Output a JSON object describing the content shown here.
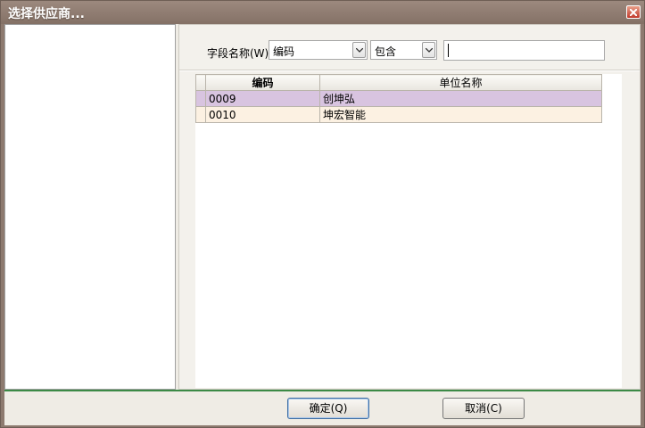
{
  "window": {
    "title": "选择供应商..."
  },
  "filter": {
    "field_label": "字段名称(W)",
    "field_value": "编码",
    "operator_value": "包含",
    "search_value": ""
  },
  "grid": {
    "headers": {
      "code": "编码",
      "name": "单位名称"
    },
    "rows": [
      {
        "code": "0009",
        "name": "创坤弘",
        "selected": true
      },
      {
        "code": "0010",
        "name": "坤宏智能",
        "selected": false
      }
    ]
  },
  "buttons": {
    "ok": "确定(Q)",
    "cancel": "取消(C)"
  }
}
